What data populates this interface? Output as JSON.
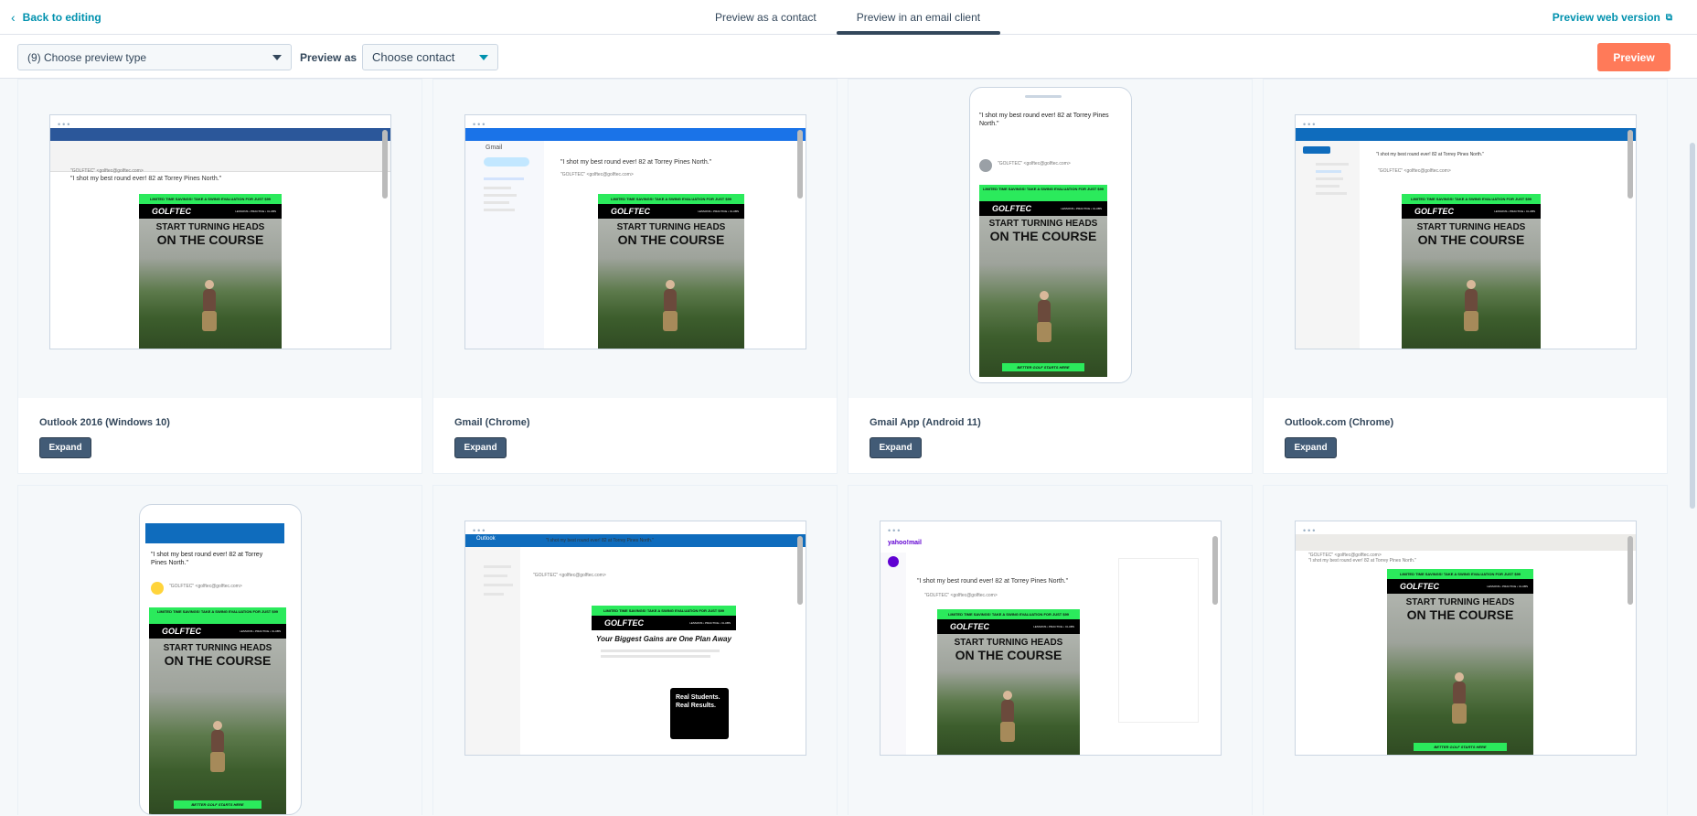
{
  "topbar": {
    "back_label": "Back to editing",
    "tabs": [
      {
        "label": "Preview as a contact"
      },
      {
        "label": "Preview in an email client"
      }
    ],
    "web_version_label": "Preview web version"
  },
  "toolbar": {
    "preview_type_value": "(9) Choose preview type",
    "preview_as_label": "Preview as",
    "contact_value": "Choose contact",
    "preview_button": "Preview"
  },
  "email": {
    "subject": "\"I shot my best round ever! 82 at Torrey Pines North.\"",
    "sender": "\"GOLFTEC\" <golftec@golftec.com>",
    "promo": "LIMITED TIME SAVINGS! TAKE A SWING EVALUATION FOR JUST $99",
    "logo": "GOLFTEC",
    "logo_tag": "LESSONS • PRACTICE • CLUBS",
    "headline1": "START TURNING HEADS",
    "headline2": "ON THE COURSE",
    "cta": "BETTER GOLF STARTS HERE"
  },
  "cards": [
    {
      "name": "Outlook 2016 (Windows 10)",
      "expand": "Expand"
    },
    {
      "name": "Gmail (Chrome)",
      "expand": "Expand"
    },
    {
      "name": "Gmail App (Android 11)",
      "expand": "Expand"
    },
    {
      "name": "Outlook.com (Chrome)",
      "expand": "Expand"
    }
  ],
  "row2_clients": {
    "gmail_label": "Gmail",
    "yahoo_label": "yahoo!mail",
    "outlook_label": "Outlook",
    "gains_heading": "Your Biggest Gains are One Plan Away",
    "real_students": "Real Students. Real Results."
  },
  "colors": {
    "accent": "#0091ae",
    "preview_button": "#ff7a59",
    "expand_button": "#425b76",
    "promo_green": "#2bea5c",
    "outlook_blue": "#0f6cbd"
  }
}
